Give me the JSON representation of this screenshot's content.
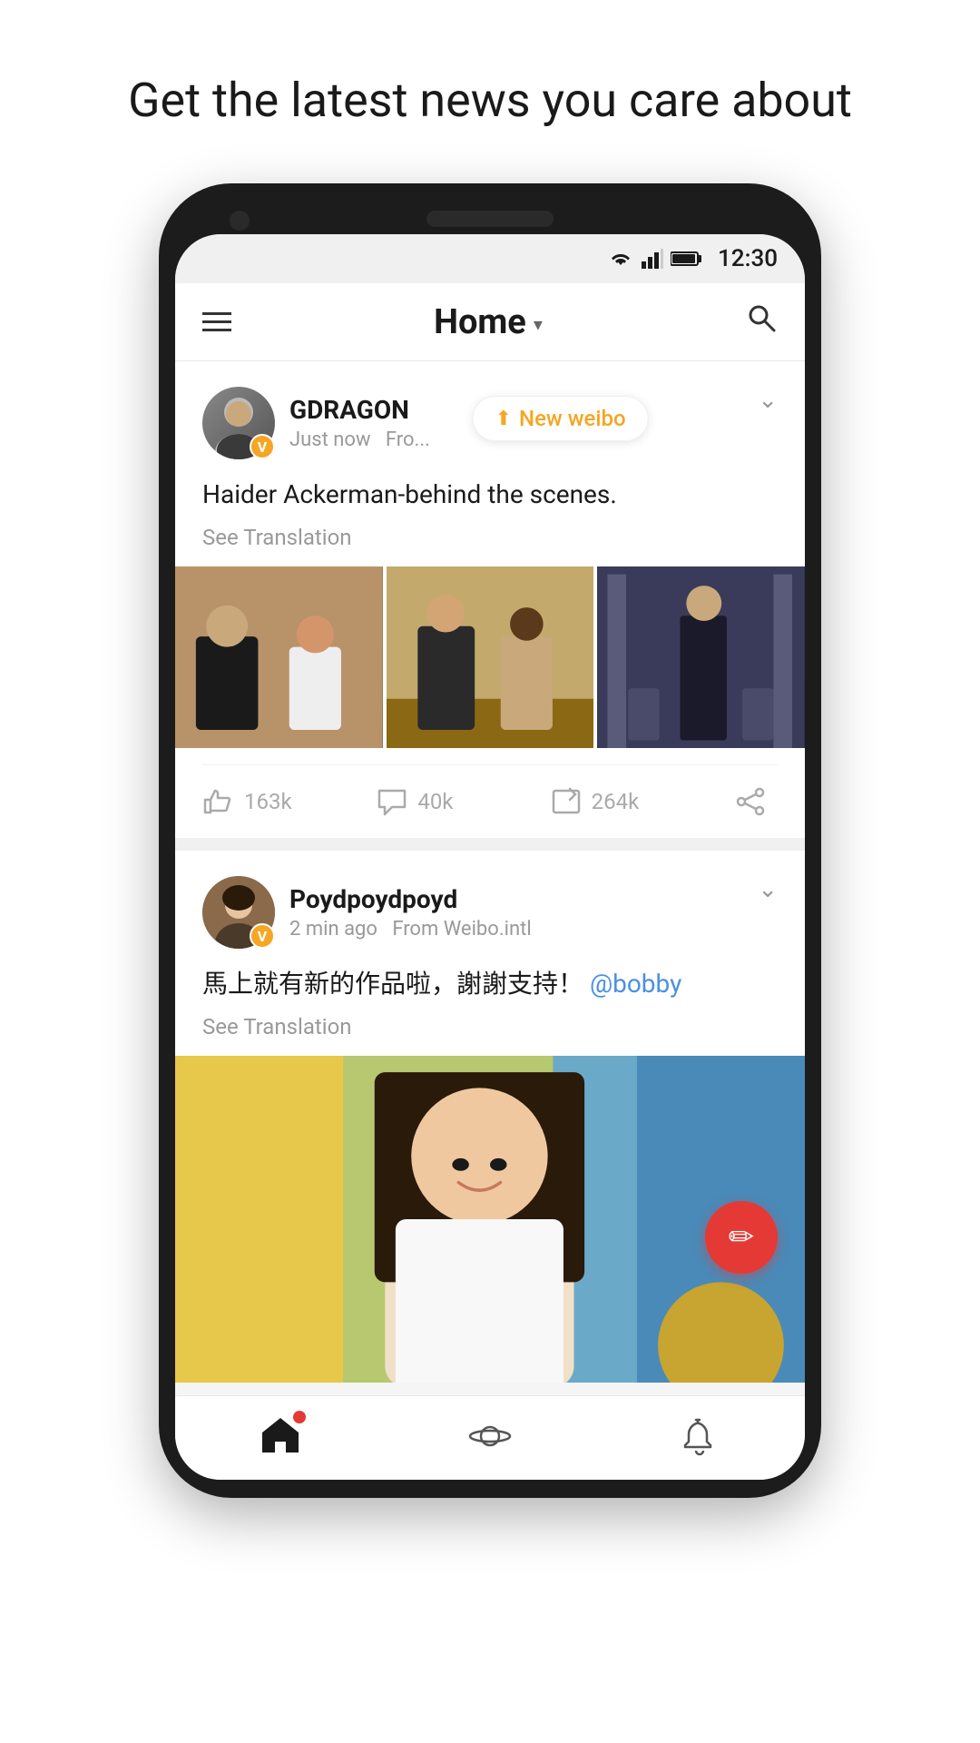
{
  "headline": "Get the latest news you care about",
  "status_bar": {
    "time": "12:30"
  },
  "header": {
    "menu_label": "Menu",
    "title": "Home",
    "dropdown_label": "Dropdown",
    "search_label": "Search"
  },
  "new_weibo_toast": "New weibo",
  "posts": [
    {
      "id": "post1",
      "author": {
        "name": "GDRAGON",
        "avatar_alt": "GDRAGON avatar",
        "verified": true,
        "verified_label": "V"
      },
      "meta": {
        "time": "Just now",
        "source": "Fro..."
      },
      "text": "Haider Ackerman-behind the scenes.",
      "see_translation": "See Translation",
      "images": [
        {
          "alt": "Behind scenes photo 1",
          "type": "scene1"
        },
        {
          "alt": "Behind scenes photo 2",
          "type": "scene2"
        },
        {
          "alt": "Behind scenes photo 3",
          "type": "scene3"
        }
      ],
      "actions": {
        "like_count": "163k",
        "comment_count": "40k",
        "repost_count": "264k"
      }
    },
    {
      "id": "post2",
      "author": {
        "name": "Poydpoydpoyd",
        "avatar_alt": "Poydpoydpoyd avatar",
        "verified": true,
        "verified_label": "V"
      },
      "meta": {
        "time": "2 min ago",
        "source": "From Weibo.intl"
      },
      "text": "馬上就有新的作品啦，謝謝支持！",
      "mention": "@bobby",
      "see_translation": "See Translation",
      "images": [
        {
          "alt": "Portrait photo",
          "type": "portrait1"
        }
      ],
      "actions": null
    }
  ],
  "fab": {
    "label": "Compose",
    "icon": "✏"
  },
  "bottom_nav": {
    "items": [
      {
        "id": "home",
        "label": "Home",
        "icon": "home",
        "active": true,
        "has_dot": true
      },
      {
        "id": "explore",
        "label": "Explore",
        "icon": "explore",
        "active": false,
        "has_dot": false
      },
      {
        "id": "notifications",
        "label": "Notifications",
        "icon": "bell",
        "active": false,
        "has_dot": false
      }
    ]
  }
}
